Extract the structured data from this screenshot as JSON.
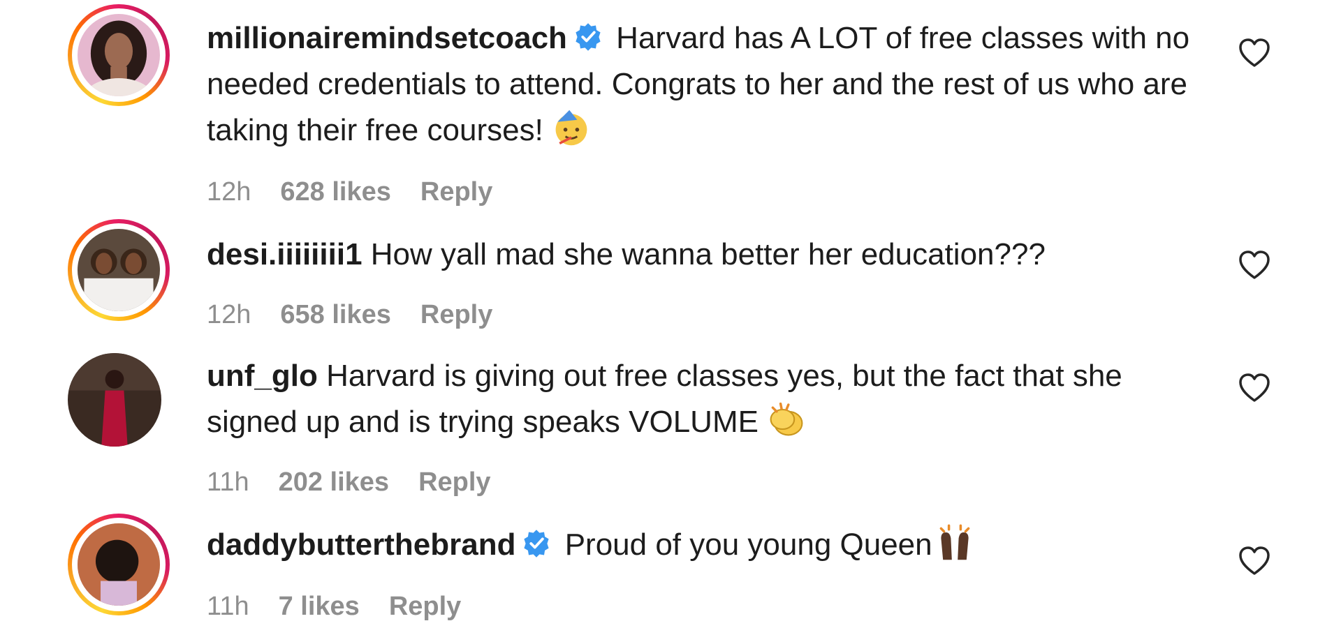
{
  "comments": [
    {
      "username": "millionairemindsetcoach",
      "verified": true,
      "text": "Harvard has A LOT of free classes with no needed credentials to attend. Congrats to her and the rest of us who are taking their free courses!",
      "emoji": "partying-face-emoji",
      "time": "12h",
      "likes": "628 likes",
      "reply": "Reply"
    },
    {
      "username": "desi.iiiiiiii1",
      "verified": false,
      "text": "How yall mad she wanna better her education???",
      "time": "12h",
      "likes": "658 likes",
      "reply": "Reply"
    },
    {
      "username": "unf_glo",
      "verified": false,
      "text": "Harvard is giving out free classes yes, but the fact that she signed up and is trying speaks VOLUME",
      "emoji": "clapping-hands-emoji",
      "time": "11h",
      "likes": "202 likes",
      "reply": "Reply"
    },
    {
      "username": "daddybutterthebrand",
      "verified": true,
      "text": "Proud of you young Queen",
      "emoji": "raising-hands-emoji",
      "time": "11h",
      "likes": "7 likes",
      "reply": "Reply"
    }
  ],
  "colors": {
    "verified_blue": "#3897f0",
    "meta_gray": "#8e8e8e",
    "text": "#1c1c1c"
  },
  "icons": {
    "like": "heart-outline-icon",
    "verified": "verified-badge-icon"
  }
}
